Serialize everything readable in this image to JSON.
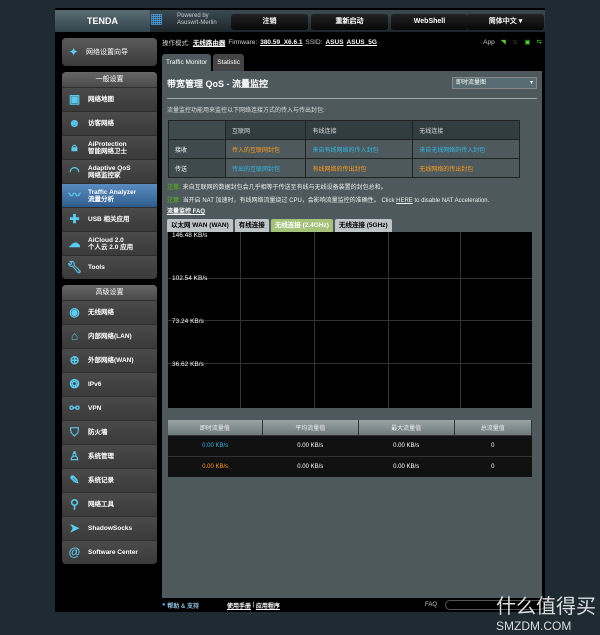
{
  "header": {
    "brand": "TENDA",
    "powered_by": "Powered by",
    "powered_name": "Asuswrt-Merlin",
    "buttons": [
      "注销",
      "重新启动",
      "WebShell",
      "简体中文"
    ]
  },
  "status": {
    "mode_label": "操作模式:",
    "mode_value": "无线路由器",
    "fw_label": "Firmware:",
    "fw_value": "380.59_X6.6.1",
    "ssid_label": "SSID:",
    "ssid1": "ASUS",
    "ssid2": "ASUS_5G",
    "app": "App"
  },
  "sidebar": {
    "wizard": "网络设置向导",
    "general_title": "一般设置",
    "general": [
      {
        "icon": "network-map-icon",
        "label": "网络地图"
      },
      {
        "icon": "guest-network-icon",
        "label": "访客网络"
      },
      {
        "icon": "lock-icon",
        "label": "AiProtection",
        "sub": "智能网络卫士"
      },
      {
        "icon": "gauge-icon",
        "label": "Adaptive QoS",
        "sub": "网络监控家"
      },
      {
        "icon": "traffic-icon",
        "label": "Traffic Analyzer",
        "sub": "流量分析"
      },
      {
        "icon": "usb-icon",
        "label": "USB 相关应用"
      },
      {
        "icon": "cloud-icon",
        "label": "AiCloud 2.0",
        "sub": "个人云 2.0 应用"
      },
      {
        "icon": "wrench-icon",
        "label": "Tools"
      }
    ],
    "advanced_title": "高级设置",
    "advanced": [
      {
        "icon": "wifi-icon",
        "label": "无线网络"
      },
      {
        "icon": "home-icon",
        "label": "内部网络(LAN)"
      },
      {
        "icon": "globe-icon",
        "label": "外部网络(WAN)"
      },
      {
        "icon": "ipv6-icon",
        "label": "IPv6"
      },
      {
        "icon": "vpn-icon",
        "label": "VPN"
      },
      {
        "icon": "shield-icon",
        "label": "防火墙"
      },
      {
        "icon": "admin-icon",
        "label": "系统管理"
      },
      {
        "icon": "log-icon",
        "label": "系统记录"
      },
      {
        "icon": "tools-icon",
        "label": "网络工具"
      },
      {
        "icon": "paper-plane-icon",
        "label": "ShadowSocks"
      },
      {
        "icon": "swirl-icon",
        "label": "Software Center"
      }
    ]
  },
  "tabs": [
    "Traffic Monitor",
    "Statistic"
  ],
  "panel": {
    "title": "带宽管理 QoS - 流量监控",
    "select": "即时流量图",
    "desc": "流量监控功能用来监控以下网络连接方式的传入与传出封包:",
    "table": {
      "headers": [
        "",
        "互联网",
        "有线连接",
        "无线连接"
      ],
      "rows": [
        [
          "接收",
          "传入的互联网封包",
          "来自有线网络的传入封包",
          "来自无线网络的传入封包"
        ],
        [
          "传送",
          "传出的互联网封包",
          "有线网络的传出封包",
          "无线网络的传出封包"
        ]
      ]
    },
    "note_label": "注意:",
    "note1": "来自互联网的数据封包会几乎相等于传送至有线与无线设备装置的封包总和。",
    "note2a": "当开启 NAT 加速时，有线网络流量绕过 CPU，会影响流量监控的准确性。 Click ",
    "note2link": "HERE",
    "note2b": " to disable NAT Acceleration.",
    "faq": "流量监控 FAQ",
    "chart_tabs": [
      "以太网 WAN (WAN)",
      "有线连接",
      "无线连接 (2.4GHz)",
      "无线连接 (5GHz)"
    ],
    "chart_ticks": [
      "146.48 KB/s",
      "102.54 KB/s",
      "73.24 KB/s",
      "36.62 KB/s"
    ],
    "stats": {
      "headers": [
        "即时流量值",
        "平均流量值",
        "最大流量值",
        "总流量值"
      ],
      "rows": [
        [
          "0.00 KB/s",
          "0.00 KB/s",
          "0.00 KB/s",
          "0"
        ],
        [
          "0.00 KB/s",
          "0.00 KB/s",
          "0.00 KB/s",
          "0"
        ]
      ]
    }
  },
  "footer": {
    "help": "帮助 & 支持",
    "manual": "使用手册",
    "apps": "应用程序",
    "faq": "FAQ"
  },
  "watermark": {
    "cn": "什么值得买",
    "en": "SMZDM.COM"
  }
}
